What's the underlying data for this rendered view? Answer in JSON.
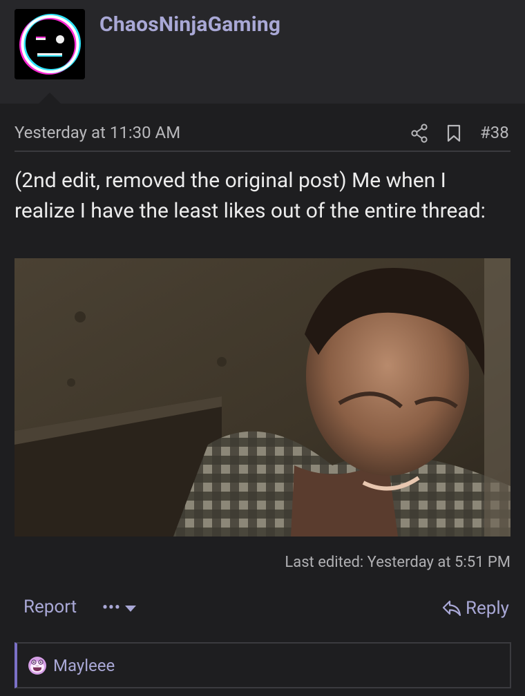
{
  "user": {
    "name": "ChaosNinjaGaming",
    "avatar_icon": "neutral-face-icon"
  },
  "post": {
    "timestamp": "Yesterday at 11:30 AM",
    "number": "#38",
    "share_icon": "share-icon",
    "bookmark_icon": "bookmark-icon",
    "body": "(2nd edit, removed the original post) Me when I realize I have the least likes out of the entire thread:",
    "image_description_icon": "gif-image",
    "last_edited": "Last edited: Yesterday at 5:51 PM"
  },
  "actions": {
    "report": "Report",
    "more": "•••",
    "reply": "Reply",
    "reply_icon": "reply-arrow-icon"
  },
  "reactions": {
    "icon": "wow-reaction-icon",
    "users": "Mayleee"
  },
  "colors": {
    "accent": "#a9a8d6",
    "background": "#1e1e20",
    "header_background": "#27272a",
    "border": "#3b3b3f",
    "reaction_bar_accent": "#7b71c7"
  }
}
